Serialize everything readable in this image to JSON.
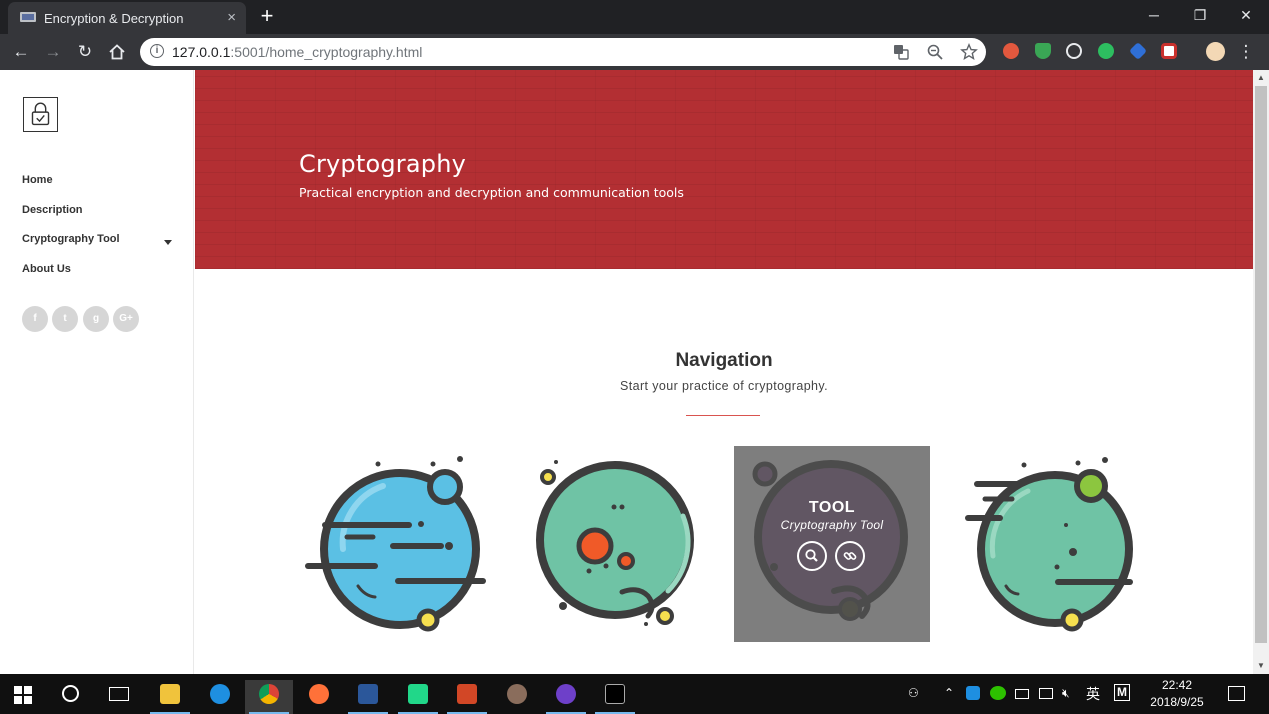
{
  "browser": {
    "tab_title": "Encryption & Decryption",
    "tab_close": "×",
    "new_tab": "+",
    "url_host": "127.0.0.1",
    "url_rest": ":5001/home_cryptography.html",
    "window_controls": {
      "minimize": "─",
      "restore": "❐",
      "close": "✕"
    }
  },
  "sidebar": {
    "menu": [
      {
        "label": "Home"
      },
      {
        "label": "Description"
      },
      {
        "label": "Cryptography Tool"
      },
      {
        "label": "About Us"
      }
    ],
    "social": [
      "f",
      "t",
      "g",
      "G+"
    ]
  },
  "hero": {
    "title": "Cryptography",
    "subtitle": "Practical encryption and decryption and communication tools"
  },
  "navigation": {
    "title": "Navigation",
    "subtitle": "Start your practice of cryptography."
  },
  "overlay": {
    "title": "TOOL",
    "subtitle": "Cryptography Tool"
  },
  "colors": {
    "hero_red": "#b32f33",
    "planet_blue": "#5bc0e4",
    "planet_green": "#6fc3a5",
    "planet_purple": "#7b4a86",
    "accent_orange": "#f05a28",
    "accent_yellow": "#f6e04f",
    "accent_lime": "#8cc63f",
    "outline": "#3d3d3d"
  },
  "taskbar": {
    "language": "英",
    "time": "22:42",
    "date": "2018/9/25"
  }
}
